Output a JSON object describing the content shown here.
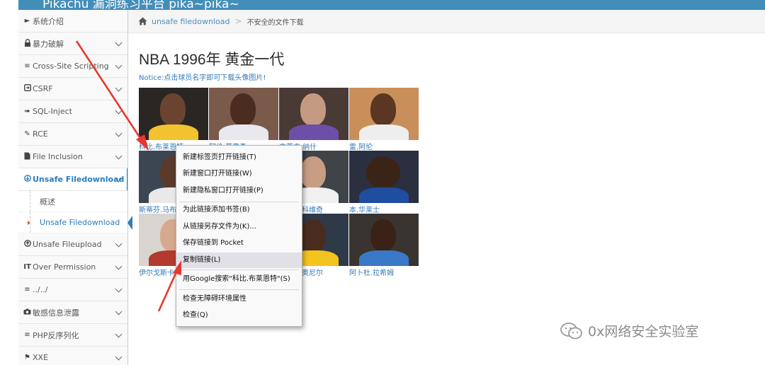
{
  "app": {
    "title": "Pikachu 漏洞练习平台 pika~pika~"
  },
  "sidebar": {
    "items": [
      {
        "label": "系统介绍",
        "icon": "tags-icon",
        "glyph": "▸"
      },
      {
        "label": "暴力破解",
        "icon": "lock-icon",
        "glyph": "■"
      },
      {
        "label": "Cross-Site Scripting",
        "icon": "list-icon",
        "glyph": "≡"
      },
      {
        "label": "CSRF",
        "icon": "external-link-icon",
        "glyph": "▣"
      },
      {
        "label": "SQL-Inject",
        "icon": "plug-icon",
        "glyph": "→"
      },
      {
        "label": "RCE",
        "icon": "pencil-icon",
        "glyph": "✎"
      },
      {
        "label": "File Inclusion",
        "icon": "file-icon",
        "glyph": "▮"
      },
      {
        "label": "Unsafe Filedownload",
        "icon": "download-circle-icon",
        "glyph": "⊕"
      },
      {
        "label": "Unsafe Fileupload",
        "icon": "upload-circle-icon",
        "glyph": "⊕"
      },
      {
        "label": "Over Permission",
        "icon": "text-cursor-icon",
        "glyph": "IT"
      },
      {
        "label": "../../",
        "icon": "align-left-icon",
        "glyph": "≡"
      },
      {
        "label": "敏感信息泄露",
        "icon": "camera-icon",
        "glyph": "◙"
      },
      {
        "label": "PHP反序列化",
        "icon": "align-left-icon",
        "glyph": "≡"
      },
      {
        "label": "XXE",
        "icon": "flag-icon",
        "glyph": "⚑"
      }
    ],
    "subitems": [
      {
        "label": "概述"
      },
      {
        "label": "Unsafe Filedownload"
      }
    ]
  },
  "breadcrumb": {
    "link": "unsafe filedownload",
    "separator": ">",
    "current": "不安全的文件下载"
  },
  "content": {
    "title": "NBA 1996年 黄金一代",
    "notice": "Notice:点击球员名字即可下载头像图片!",
    "players": [
      {
        "name": "科比.布莱恩特"
      },
      {
        "name": "阿伦.艾弗森"
      },
      {
        "name": "史蒂夫.纳什"
      },
      {
        "name": "雷.阿伦"
      },
      {
        "name": "斯蒂芬.马布里"
      },
      {
        "name": ""
      },
      {
        "name": "佩贾.斯托贾科维奇"
      },
      {
        "name": "本.华莱士"
      },
      {
        "name": "伊尔戈斯卡斯"
      },
      {
        "name": ""
      },
      {
        "name": "杰梅因.奥尼尔"
      },
      {
        "name": "阿卜杜.拉希姆"
      }
    ],
    "row2_name_partial_left": "斯蒂芬.马布",
    "row2_name_partial_right": "科维奇",
    "row3_name_partial_left": "伊尔戈斯卡",
    "row3_name_partial_right": "奥尼尔",
    "row1_name_partial_0": "科比.布莱恩特",
    "row1_name_partial_1": "阿伦.艾弗森",
    "row1_name_partial_2": "史蒂夫.纳什"
  },
  "context_menu": {
    "items": [
      {
        "label": "新建标签页打开链接(T)"
      },
      {
        "label": "新建窗口打开链接(W)"
      },
      {
        "label": "新建隐私窗口打开链接(P)"
      },
      {
        "label": "为此链接添加书签(B)"
      },
      {
        "label": "从链接另存文件为(K)..."
      },
      {
        "label": "保存链接到 Pocket"
      },
      {
        "label": "复制链接(L)",
        "highlighted": true
      },
      {
        "label": "用Google搜索\"科比.布莱恩特\"(S)"
      },
      {
        "label": "检查无障碍环境属性"
      },
      {
        "label": "检查(Q)"
      }
    ]
  },
  "watermark": {
    "text": "0x网络安全实验室"
  },
  "colors": {
    "brand_blue": "#438eb9",
    "link_blue": "#337ab7",
    "active_blue": "#2b7dbc",
    "annotation_red": "#e8382f"
  }
}
